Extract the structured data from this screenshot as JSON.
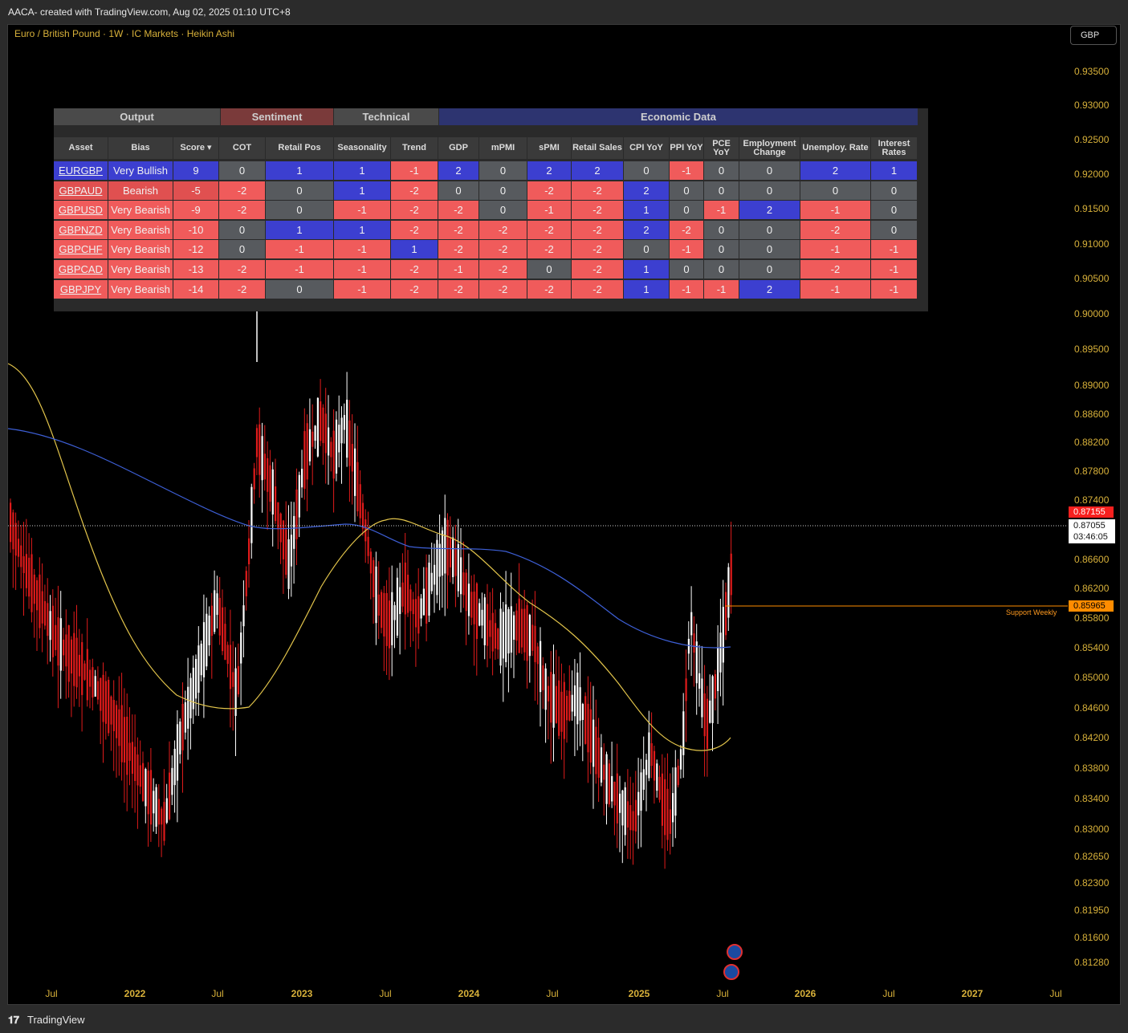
{
  "header": {
    "caption": "AACA- created with TradingView.com, Aug 02, 2025 01:10 UTC+8",
    "symbol_title": "Euro / British Pound · 1W · IC Markets · Heikin Ashi",
    "currency_button": "GBP"
  },
  "price_axis": [
    "0.93500",
    "0.93000",
    "0.92500",
    "0.92000",
    "0.91500",
    "0.91000",
    "0.90500",
    "0.90000",
    "0.89500",
    "0.89000",
    "0.88600",
    "0.88200",
    "0.87800",
    "0.87400",
    "0.87000",
    "0.86600",
    "0.86200",
    "0.85800",
    "0.85400",
    "0.85000",
    "0.84600",
    "0.84200",
    "0.83800",
    "0.83400",
    "0.83000",
    "0.82650",
    "0.82300",
    "0.81950",
    "0.81600",
    "0.81280"
  ],
  "price_tags": {
    "high": "0.87155",
    "last": "0.87055",
    "countdown": "03:46:05",
    "support": "0.85965",
    "support_label": "Support Weekly"
  },
  "date_axis": [
    {
      "label": "Jul",
      "year": false
    },
    {
      "label": "2022",
      "year": true
    },
    {
      "label": "Jul",
      "year": false
    },
    {
      "label": "2023",
      "year": true
    },
    {
      "label": "Jul",
      "year": false
    },
    {
      "label": "2024",
      "year": true
    },
    {
      "label": "Jul",
      "year": false
    },
    {
      "label": "2025",
      "year": true
    },
    {
      "label": "Jul",
      "year": false
    },
    {
      "label": "2026",
      "year": true
    },
    {
      "label": "Jul",
      "year": false
    },
    {
      "label": "2027",
      "year": true
    },
    {
      "label": "Jul",
      "year": false
    }
  ],
  "table": {
    "groups": [
      {
        "label": "Output",
        "bg": "#4a4a4a",
        "color": "#cfcfcf"
      },
      {
        "label": "Sentiment",
        "bg": "#7a3a3a",
        "color": "#cfcfcf"
      },
      {
        "label": "Technical",
        "bg": "#4a4a4a",
        "color": "#cfcfcf"
      },
      {
        "label": "Economic Data",
        "bg": "#2d3470",
        "color": "#cfcfcf"
      }
    ],
    "columns": [
      "Asset",
      "Bias",
      "Score ▾",
      "COT",
      "Retail Pos",
      "Seasonality",
      "Trend",
      "GDP",
      "mPMI",
      "sPMI",
      "Retail Sales",
      "CPI YoY",
      "PPI YoY",
      "PCE YoY",
      "Employment Change",
      "Unemploy. Rate",
      "Interest Rates"
    ],
    "rows": [
      {
        "asset": "EURGBP",
        "bias": "Very Bullish",
        "score": "9",
        "values": [
          "0",
          "1",
          "1",
          "-1",
          "2",
          "0",
          "2",
          "2",
          "0",
          "-1",
          "0",
          "0",
          "2",
          "1"
        ]
      },
      {
        "asset": "GBPAUD",
        "bias": "Bearish",
        "score": "-5",
        "values": [
          "-2",
          "0",
          "1",
          "-2",
          "0",
          "0",
          "-2",
          "-2",
          "2",
          "0",
          "0",
          "0",
          "0",
          "0"
        ]
      },
      {
        "asset": "GBPUSD",
        "bias": "Very Bearish",
        "score": "-9",
        "values": [
          "-2",
          "0",
          "-1",
          "-2",
          "-2",
          "0",
          "-1",
          "-2",
          "1",
          "0",
          "-1",
          "2",
          "-1",
          "0"
        ]
      },
      {
        "asset": "GBPNZD",
        "bias": "Very Bearish",
        "score": "-10",
        "values": [
          "0",
          "1",
          "1",
          "-2",
          "-2",
          "-2",
          "-2",
          "-2",
          "2",
          "-2",
          "0",
          "0",
          "-2",
          "0"
        ]
      },
      {
        "asset": "GBPCHF",
        "bias": "Very Bearish",
        "score": "-12",
        "values": [
          "0",
          "-1",
          "-1",
          "1",
          "-2",
          "-2",
          "-2",
          "-2",
          "0",
          "-1",
          "0",
          "0",
          "-1",
          "-1"
        ]
      },
      {
        "asset": "GBPCAD",
        "bias": "Very Bearish",
        "score": "-13",
        "values": [
          "-2",
          "-1",
          "-1",
          "-2",
          "-1",
          "-2",
          "0",
          "-2",
          "1",
          "0",
          "0",
          "0",
          "-2",
          "-1"
        ]
      },
      {
        "asset": "GBPJPY",
        "bias": "Very Bearish",
        "score": "-14",
        "values": [
          "-2",
          "0",
          "-1",
          "-2",
          "-2",
          "-2",
          "-2",
          "-2",
          "1",
          "-1",
          "-1",
          "2",
          "-1",
          "-1"
        ]
      }
    ],
    "colors": {
      "positive": "#3c3fd0",
      "neutral": "#575a5e",
      "negative": "#f05b5b",
      "bullish_row": "#3c3fd0",
      "bearish_row": "#e05050",
      "very_bearish_row": "#f05b5b"
    }
  },
  "footer": {
    "brand_mark": "𝟏𝟕",
    "brand_name": "TradingView"
  },
  "colors": {
    "up_candle": "#ffffff",
    "down_candle": "#e01b1b",
    "ma_fast": "#e3c54b",
    "ma_slow": "#3d5fd6",
    "axis_text": "#d8b13a"
  }
}
